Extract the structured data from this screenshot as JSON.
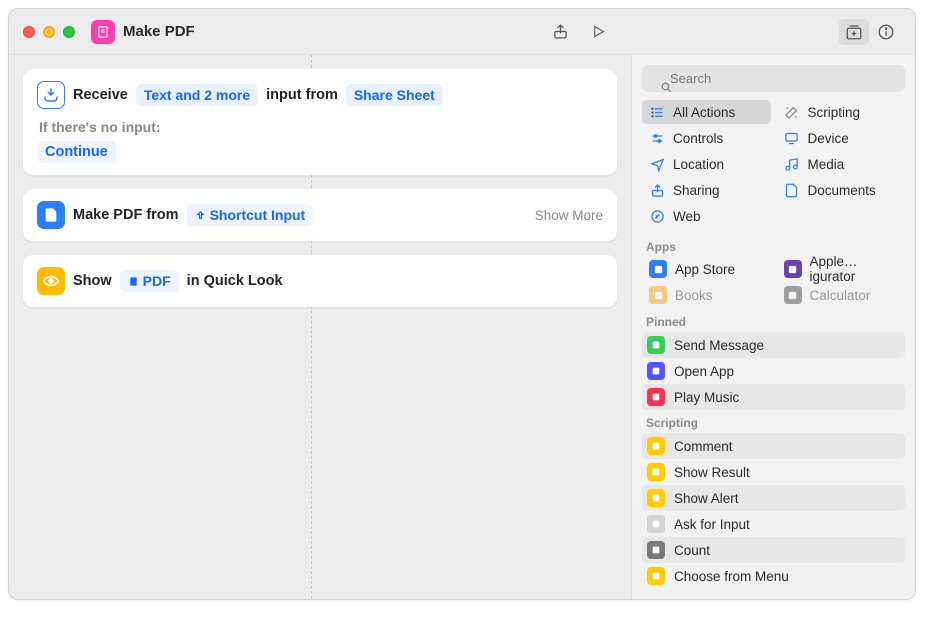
{
  "window": {
    "title": "Make PDF"
  },
  "editor": {
    "receive": {
      "label": "Receive",
      "types": "Text and 2 more",
      "from_text": "input from",
      "source": "Share Sheet",
      "no_input_label": "If there's no input:",
      "continue": "Continue"
    },
    "make": {
      "label": "Make PDF from",
      "input": "Shortcut Input",
      "show_more": "Show More"
    },
    "show": {
      "label": "Show",
      "pdf": "PDF",
      "suffix": "in Quick Look"
    }
  },
  "search": {
    "placeholder": "Search"
  },
  "categories": [
    {
      "label": "All Actions",
      "icon": "list",
      "color": "#2d7ff9",
      "selected": true
    },
    {
      "label": "Scripting",
      "icon": "wand",
      "color": "#8c8c8c"
    },
    {
      "label": "Controls",
      "icon": "slider",
      "color": "#2d7ff9"
    },
    {
      "label": "Device",
      "icon": "monitor",
      "color": "#2d7ff9"
    },
    {
      "label": "Location",
      "icon": "nav",
      "color": "#2d7ff9"
    },
    {
      "label": "Media",
      "icon": "music",
      "color": "#2d7ff9"
    },
    {
      "label": "Sharing",
      "icon": "share",
      "color": "#2d7ff9"
    },
    {
      "label": "Documents",
      "icon": "doc",
      "color": "#2d7ff9"
    },
    {
      "label": "Web",
      "icon": "safari",
      "color": "#2d7ff9"
    }
  ],
  "sections": {
    "apps": {
      "label": "Apps",
      "items": [
        {
          "label": "App Store",
          "color": "#2d7ff9"
        },
        {
          "label": "Apple…igurator",
          "color": "#6b3fb8"
        },
        {
          "label": "Books",
          "color": "#ff9500"
        },
        {
          "label": "Calculator",
          "color": "#3a3a3a"
        }
      ]
    },
    "pinned": {
      "label": "Pinned",
      "items": [
        {
          "label": "Send Message",
          "color": "#30d158"
        },
        {
          "label": "Open App",
          "color": "#5654ff"
        },
        {
          "label": "Play Music",
          "color": "#ff3154"
        }
      ]
    },
    "scripting": {
      "label": "Scripting",
      "items": [
        {
          "label": "Comment",
          "color": "#ffcc00"
        },
        {
          "label": "Show Result",
          "color": "#ffcc00"
        },
        {
          "label": "Show Alert",
          "color": "#ffcc00"
        },
        {
          "label": "Ask for Input",
          "color": "#d1d1d1"
        },
        {
          "label": "Count",
          "color": "#7a7a7a"
        },
        {
          "label": "Choose from Menu",
          "color": "#ffcc00"
        }
      ]
    }
  }
}
